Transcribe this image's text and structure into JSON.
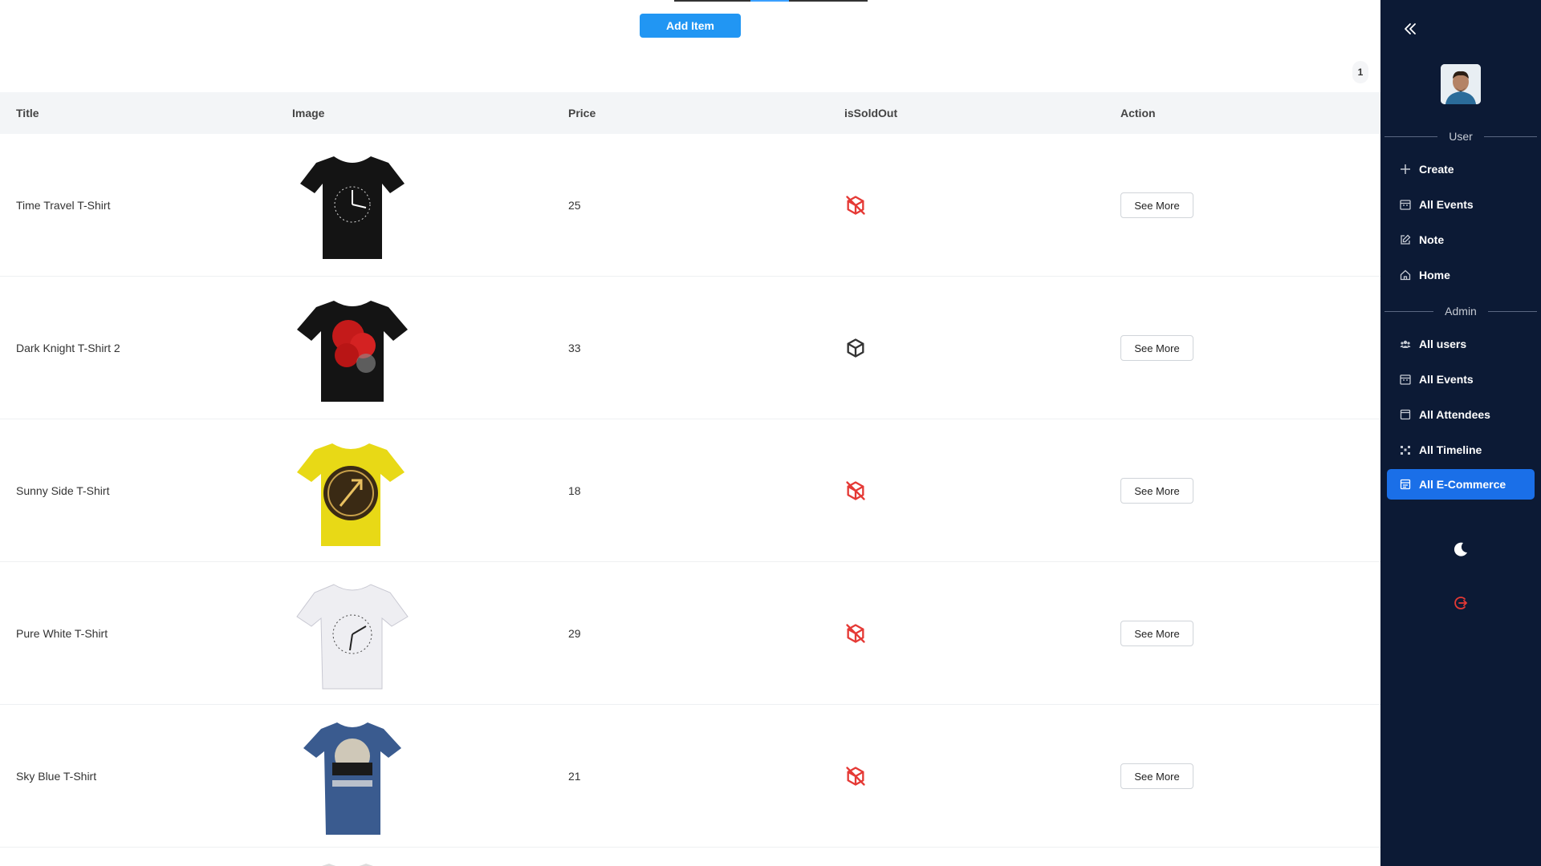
{
  "toolbar": {
    "add_label": "Add Item"
  },
  "pagination": {
    "current_page": "1"
  },
  "table": {
    "headers": [
      "Title",
      "Image",
      "Price",
      "isSoldOut",
      "Action"
    ],
    "rows": [
      {
        "title": "Time Travel T-Shirt",
        "image_icon": "black-tshirt-clock",
        "price": "25",
        "sold_out": true,
        "action": "See More"
      },
      {
        "title": "Dark Knight T-Shirt 2",
        "image_icon": "black-tshirt-red-print",
        "price": "33",
        "sold_out": false,
        "action": "See More"
      },
      {
        "title": "Sunny Side T-Shirt",
        "image_icon": "yellow-tshirt-clock",
        "price": "18",
        "sold_out": true,
        "action": "See More"
      },
      {
        "title": "Pure White T-Shirt",
        "image_icon": "white-tshirt-clock",
        "price": "29",
        "sold_out": true,
        "action": "See More"
      },
      {
        "title": "Sky Blue T-Shirt",
        "image_icon": "blue-tshirt-print",
        "price": "21",
        "sold_out": true,
        "action": "See More"
      }
    ]
  },
  "sidebar": {
    "sections": {
      "user": "User",
      "admin": "Admin"
    },
    "user_items": [
      {
        "label": "Create",
        "icon": "plus-icon"
      },
      {
        "label": "All Events",
        "icon": "calendar-icon"
      },
      {
        "label": "Note",
        "icon": "edit-icon"
      },
      {
        "label": "Home",
        "icon": "home-icon"
      }
    ],
    "admin_items": [
      {
        "label": "All users",
        "icon": "users-icon"
      },
      {
        "label": "All Events",
        "icon": "calendar-icon"
      },
      {
        "label": "All Attendees",
        "icon": "attendees-icon"
      },
      {
        "label": "All Timeline",
        "icon": "timeline-icon"
      },
      {
        "label": "All E-Commerce",
        "icon": "shop-icon",
        "active": true
      }
    ]
  },
  "colors": {
    "accent": "#2196f3",
    "sidebar_bg": "#0c1a35",
    "active_nav": "#1a6fe8",
    "sold_out_icon": "#e53935",
    "in_stock_icon": "#333333"
  }
}
